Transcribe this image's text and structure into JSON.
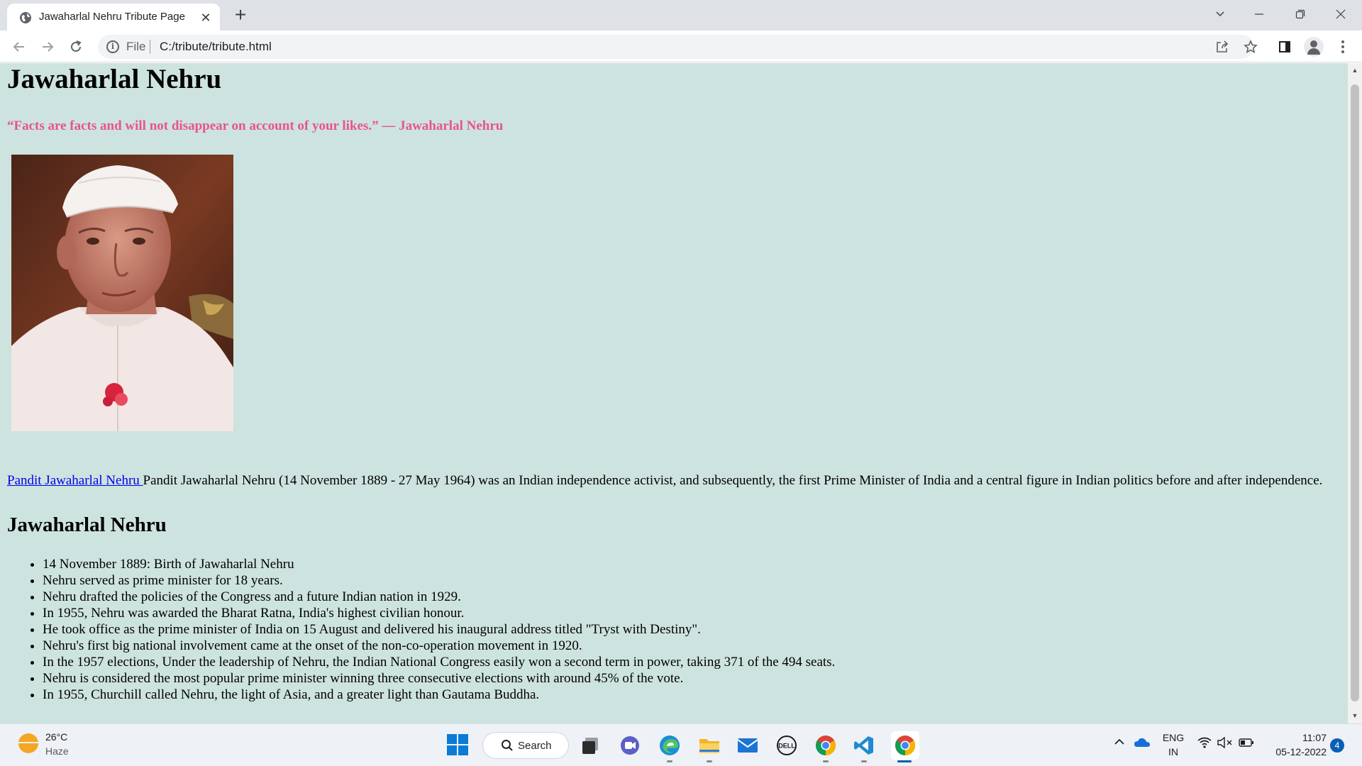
{
  "browser": {
    "tab_title": "Jawaharlal Nehru Tribute Page",
    "tab_close": "✕",
    "new_tab": "+",
    "scheme_label": "File",
    "url": "C:/tribute/tribute.html"
  },
  "page": {
    "heading": "Jawaharlal Nehru",
    "quote": "“Facts are facts and will not disappear on account of your likes.” — Jawaharlal Nehru",
    "intro_link": "Pandit Jawaharlal Nehru ",
    "intro_text": "Pandit Jawaharlal Nehru (14 November 1889 - 27 May 1964) was an Indian independence activist, and subsequently, the first Prime Minister of India and a central figure in Indian politics before and after independence.",
    "subheading": "Jawaharlal Nehru",
    "facts": [
      "14 November 1889: Birth of Jawaharlal Nehru",
      "Nehru served as prime minister for 18 years.",
      "Nehru drafted the policies of the Congress and a future Indian nation in 1929.",
      "In 1955, Nehru was awarded the Bharat Ratna, India's highest civilian honour.",
      "He took office as the prime minister of India on 15 August and delivered his inaugural address titled \"Tryst with Destiny\".",
      "Nehru's first big national involvement came at the onset of the non-co-operation movement in 1920.",
      "In the 1957 elections, Under the leadership of Nehru, the Indian National Congress easily won a second term in power, taking 371 of the 494 seats.",
      "Nehru is considered the most popular prime minister winning three consecutive elections with around 45% of the vote.",
      "In 1955, Churchill called Nehru, the light of Asia, and a greater light than Gautama Buddha."
    ]
  },
  "taskbar": {
    "weather_temp": "26°C",
    "weather_desc": "Haze",
    "search_label": "Search",
    "lang_primary": "ENG",
    "lang_secondary": "IN",
    "time": "11:07",
    "date": "05-12-2022",
    "notification_count": "4"
  },
  "colors": {
    "page_background": "#cde3df",
    "quote": "#e8548a",
    "link": "#0000ee"
  }
}
